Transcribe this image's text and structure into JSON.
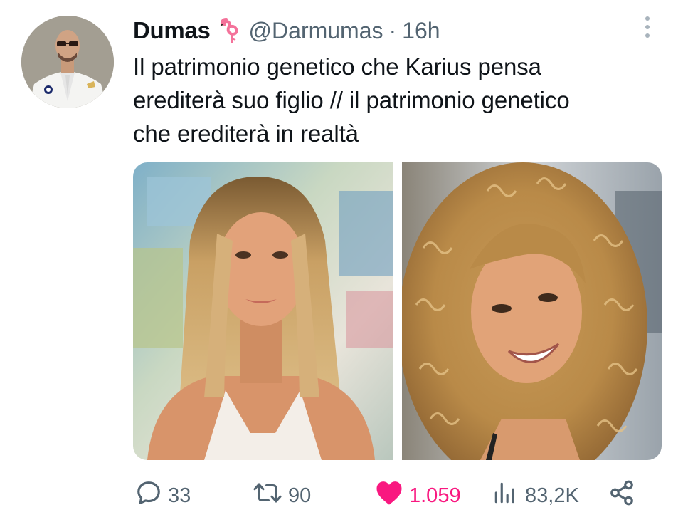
{
  "tweet": {
    "display_name": "Dumas",
    "handle": "@Darmumas",
    "separator": "·",
    "time": "16h",
    "text": "Il patrimonio genetico che Karius pensa\nerediterà suo figlio // il patrimonio genetico\nche erediterà in realtà"
  },
  "icons": {
    "name_emoji": "flamingo-icon",
    "more": "more-vertical-icon",
    "reply": "reply-icon",
    "retweet": "retweet-icon",
    "like": "heart-icon",
    "views": "views-icon",
    "share": "share-icon"
  },
  "actions": {
    "replies": "33",
    "retweets": "90",
    "likes": "1.059",
    "views": "83,2K"
  },
  "colors": {
    "text_primary": "#0f1419",
    "text_secondary": "#536471",
    "like_active": "#f91880"
  }
}
